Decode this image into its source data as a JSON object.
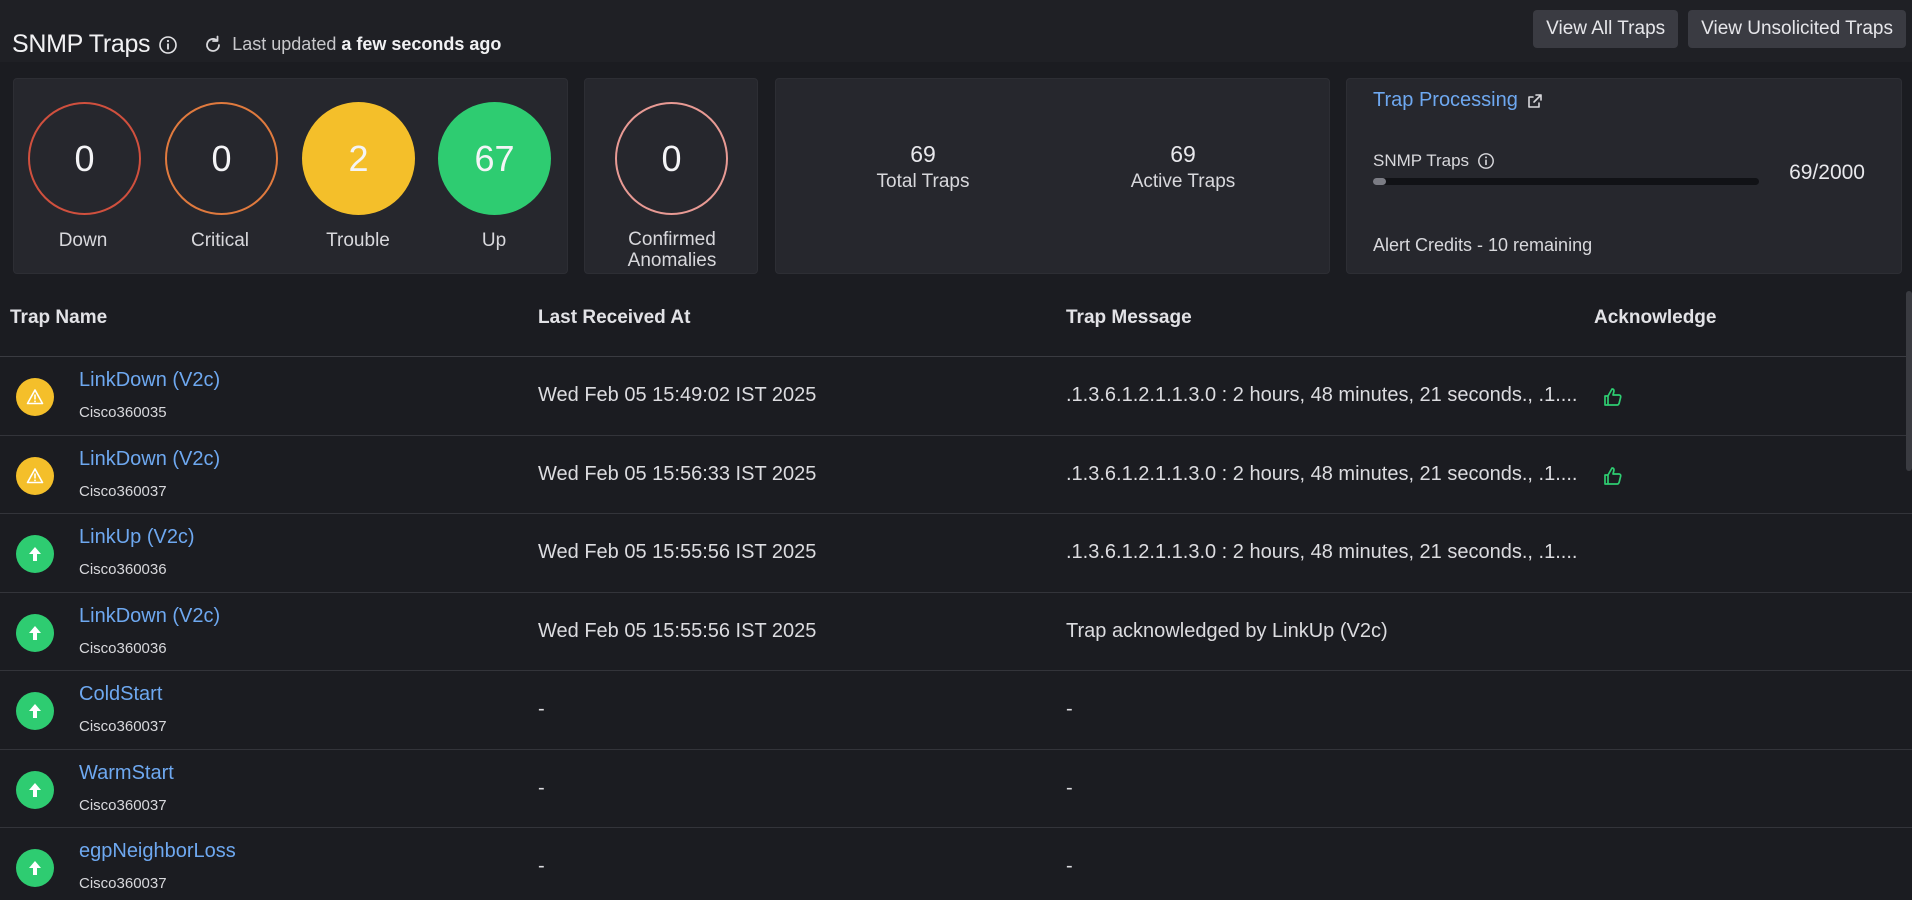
{
  "header": {
    "title": "SNMP Traps",
    "last_updated_prefix": "Last updated",
    "last_updated_value": "a few seconds ago",
    "buttons": [
      "View All Traps",
      "View Unsolicited Traps"
    ]
  },
  "status_summary": [
    {
      "value": "0",
      "label": "Down",
      "color": "#d0503e"
    },
    {
      "value": "0",
      "label": "Critical",
      "color": "#e07a3e"
    },
    {
      "value": "2",
      "label": "Trouble",
      "color": "#f4bf2a"
    },
    {
      "value": "67",
      "label": "Up",
      "color": "#2ecc71"
    }
  ],
  "anomalies": {
    "value": "0",
    "label_line1": "Confirmed",
    "label_line2": "Anomalies",
    "color": "#e89a94"
  },
  "trap_counts": {
    "total_value": "69",
    "total_label": "Total Traps",
    "active_value": "69",
    "active_label": "Active Traps"
  },
  "trap_processing": {
    "link": "Trap Processing",
    "usage_label": "SNMP Traps",
    "usage_count": "69/2000",
    "usage_fraction": 0.0345,
    "credits": "Alert Credits - 10 remaining"
  },
  "table": {
    "columns": [
      "Trap Name",
      "Last Received At",
      "Trap Message",
      "Acknowledge"
    ],
    "rows": [
      {
        "name": "LinkDown (V2c)",
        "device": "Cisco360035",
        "received": "Wed Feb 05 15:49:02 IST 2025",
        "message": ".1.3.6.1.2.1.1.3.0 : 2 hours, 48 minutes, 21 seconds., .1....",
        "status": "trouble",
        "ack": true
      },
      {
        "name": "LinkDown (V2c)",
        "device": "Cisco360037",
        "received": "Wed Feb 05 15:56:33 IST 2025",
        "message": ".1.3.6.1.2.1.1.3.0 : 2 hours, 48 minutes, 21 seconds., .1....",
        "status": "trouble",
        "ack": true
      },
      {
        "name": "LinkUp (V2c)",
        "device": "Cisco360036",
        "received": "Wed Feb 05 15:55:56 IST 2025",
        "message": ".1.3.6.1.2.1.1.3.0 : 2 hours, 48 minutes, 21 seconds., .1....",
        "status": "up",
        "ack": false
      },
      {
        "name": "LinkDown (V2c)",
        "device": "Cisco360036",
        "received": "Wed Feb 05 15:55:56 IST 2025",
        "message": "Trap acknowledged by LinkUp (V2c)",
        "status": "up",
        "ack": false
      },
      {
        "name": "ColdStart",
        "device": "Cisco360037",
        "received": "-",
        "message": "-",
        "status": "up",
        "ack": false
      },
      {
        "name": "WarmStart",
        "device": "Cisco360037",
        "received": "-",
        "message": "-",
        "status": "up",
        "ack": false
      },
      {
        "name": "egpNeighborLoss",
        "device": "Cisco360037",
        "received": "-",
        "message": "-",
        "status": "up",
        "ack": false
      }
    ]
  },
  "colors": {
    "trouble": "#f4bf2a",
    "up": "#2ecc71",
    "link": "#6ea8f0",
    "ack": "#2ecc71"
  }
}
